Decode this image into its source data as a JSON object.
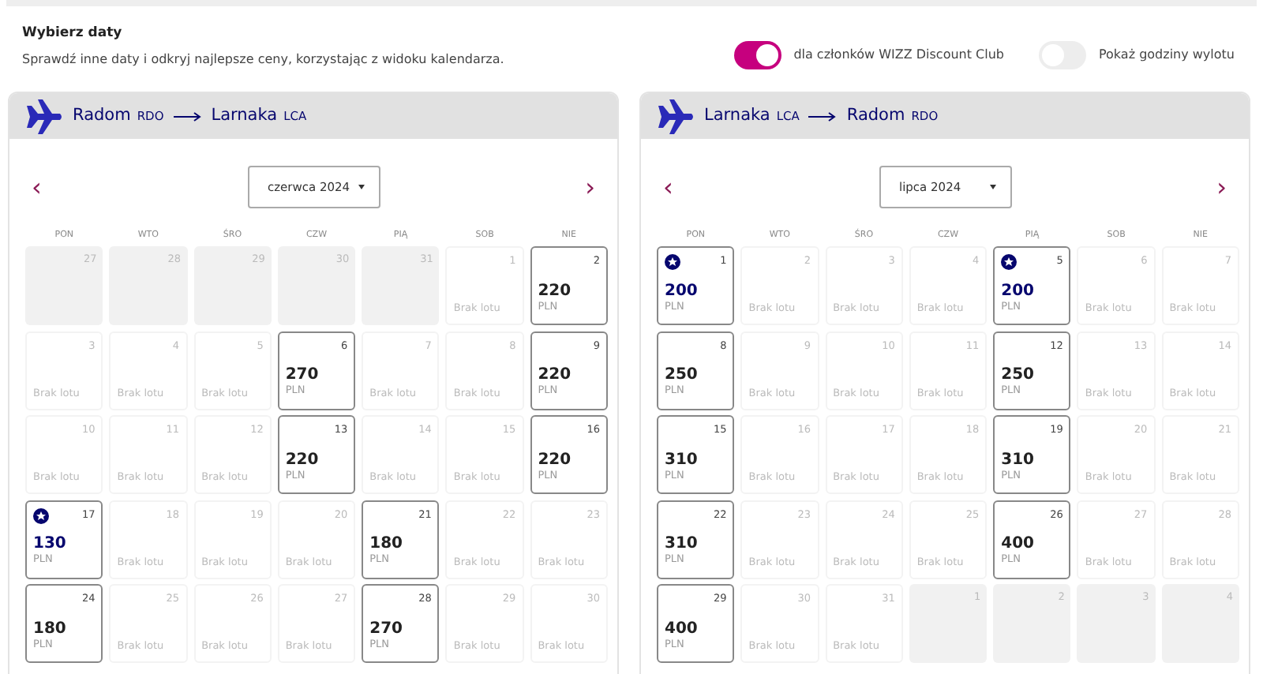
{
  "header": {
    "title": "Wybierz daty",
    "subtitle": "Sprawdź inne daty i odkryj najlepsze ceny, korzystając z widoku kalendarza."
  },
  "toggles": [
    {
      "label": "dla członków WIZZ Discount Club",
      "on": true
    },
    {
      "label": "Pokaż godziny wylotu",
      "on": false
    }
  ],
  "calendars": [
    {
      "route": {
        "from_city": "Radom",
        "from_code": "RDO",
        "to_city": "Larnaka",
        "to_code": "LCA"
      },
      "prev": "‹",
      "next": "›",
      "month": "czerwca 2024",
      "weekdays": [
        "PON",
        "WTO",
        "ŚRO",
        "CZW",
        "PIĄ",
        "SOB",
        "NIE"
      ],
      "days": [
        {
          "kind": "outside",
          "day": "27"
        },
        {
          "kind": "outside",
          "day": "28"
        },
        {
          "kind": "outside",
          "day": "29"
        },
        {
          "kind": "outside",
          "day": "30"
        },
        {
          "kind": "outside",
          "day": "31"
        },
        {
          "kind": "none",
          "day": "1",
          "note": "Brak lotu"
        },
        {
          "kind": "price",
          "day": "2",
          "price": "220",
          "currency": "PLN",
          "discount": false
        },
        {
          "kind": "none",
          "day": "3",
          "note": "Brak lotu"
        },
        {
          "kind": "none",
          "day": "4",
          "note": "Brak lotu"
        },
        {
          "kind": "none",
          "day": "5",
          "note": "Brak lotu"
        },
        {
          "kind": "price",
          "day": "6",
          "price": "270",
          "currency": "PLN",
          "discount": false
        },
        {
          "kind": "none",
          "day": "7",
          "note": "Brak lotu"
        },
        {
          "kind": "none",
          "day": "8",
          "note": "Brak lotu"
        },
        {
          "kind": "price",
          "day": "9",
          "price": "220",
          "currency": "PLN",
          "discount": false
        },
        {
          "kind": "none",
          "day": "10",
          "note": "Brak lotu"
        },
        {
          "kind": "none",
          "day": "11",
          "note": "Brak lotu"
        },
        {
          "kind": "none",
          "day": "12",
          "note": "Brak lotu"
        },
        {
          "kind": "price",
          "day": "13",
          "price": "220",
          "currency": "PLN",
          "discount": false
        },
        {
          "kind": "none",
          "day": "14",
          "note": "Brak lotu"
        },
        {
          "kind": "none",
          "day": "15",
          "note": "Brak lotu"
        },
        {
          "kind": "price",
          "day": "16",
          "price": "220",
          "currency": "PLN",
          "discount": false
        },
        {
          "kind": "price",
          "day": "17",
          "price": "130",
          "currency": "PLN",
          "discount": true
        },
        {
          "kind": "none",
          "day": "18",
          "note": "Brak lotu"
        },
        {
          "kind": "none",
          "day": "19",
          "note": "Brak lotu"
        },
        {
          "kind": "none",
          "day": "20",
          "note": "Brak lotu"
        },
        {
          "kind": "price",
          "day": "21",
          "price": "180",
          "currency": "PLN",
          "discount": false
        },
        {
          "kind": "none",
          "day": "22",
          "note": "Brak lotu"
        },
        {
          "kind": "none",
          "day": "23",
          "note": "Brak lotu"
        },
        {
          "kind": "price",
          "day": "24",
          "price": "180",
          "currency": "PLN",
          "discount": false
        },
        {
          "kind": "none",
          "day": "25",
          "note": "Brak lotu"
        },
        {
          "kind": "none",
          "day": "26",
          "note": "Brak lotu"
        },
        {
          "kind": "none",
          "day": "27",
          "note": "Brak lotu"
        },
        {
          "kind": "price",
          "day": "28",
          "price": "270",
          "currency": "PLN",
          "discount": false
        },
        {
          "kind": "none",
          "day": "29",
          "note": "Brak lotu"
        },
        {
          "kind": "none",
          "day": "30",
          "note": "Brak lotu"
        }
      ]
    },
    {
      "route": {
        "from_city": "Larnaka",
        "from_code": "LCA",
        "to_city": "Radom",
        "to_code": "RDO"
      },
      "prev": "‹",
      "next": "›",
      "month": "lipca 2024",
      "weekdays": [
        "PON",
        "WTO",
        "ŚRO",
        "CZW",
        "PIĄ",
        "SOB",
        "NIE"
      ],
      "days": [
        {
          "kind": "price",
          "day": "1",
          "price": "200",
          "currency": "PLN",
          "discount": true
        },
        {
          "kind": "none",
          "day": "2",
          "note": "Brak lotu"
        },
        {
          "kind": "none",
          "day": "3",
          "note": "Brak lotu"
        },
        {
          "kind": "none",
          "day": "4",
          "note": "Brak lotu"
        },
        {
          "kind": "price",
          "day": "5",
          "price": "200",
          "currency": "PLN",
          "discount": true
        },
        {
          "kind": "none",
          "day": "6",
          "note": "Brak lotu"
        },
        {
          "kind": "none",
          "day": "7",
          "note": "Brak lotu"
        },
        {
          "kind": "price",
          "day": "8",
          "price": "250",
          "currency": "PLN",
          "discount": false
        },
        {
          "kind": "none",
          "day": "9",
          "note": "Brak lotu"
        },
        {
          "kind": "none",
          "day": "10",
          "note": "Brak lotu"
        },
        {
          "kind": "none",
          "day": "11",
          "note": "Brak lotu"
        },
        {
          "kind": "price",
          "day": "12",
          "price": "250",
          "currency": "PLN",
          "discount": false
        },
        {
          "kind": "none",
          "day": "13",
          "note": "Brak lotu"
        },
        {
          "kind": "none",
          "day": "14",
          "note": "Brak lotu"
        },
        {
          "kind": "price",
          "day": "15",
          "price": "310",
          "currency": "PLN",
          "discount": false
        },
        {
          "kind": "none",
          "day": "16",
          "note": "Brak lotu"
        },
        {
          "kind": "none",
          "day": "17",
          "note": "Brak lotu"
        },
        {
          "kind": "none",
          "day": "18",
          "note": "Brak lotu"
        },
        {
          "kind": "price",
          "day": "19",
          "price": "310",
          "currency": "PLN",
          "discount": false
        },
        {
          "kind": "none",
          "day": "20",
          "note": "Brak lotu"
        },
        {
          "kind": "none",
          "day": "21",
          "note": "Brak lotu"
        },
        {
          "kind": "price",
          "day": "22",
          "price": "310",
          "currency": "PLN",
          "discount": false
        },
        {
          "kind": "none",
          "day": "23",
          "note": "Brak lotu"
        },
        {
          "kind": "none",
          "day": "24",
          "note": "Brak lotu"
        },
        {
          "kind": "none",
          "day": "25",
          "note": "Brak lotu"
        },
        {
          "kind": "price",
          "day": "26",
          "price": "400",
          "currency": "PLN",
          "discount": false
        },
        {
          "kind": "none",
          "day": "27",
          "note": "Brak lotu"
        },
        {
          "kind": "none",
          "day": "28",
          "note": "Brak lotu"
        },
        {
          "kind": "price",
          "day": "29",
          "price": "400",
          "currency": "PLN",
          "discount": false
        },
        {
          "kind": "none",
          "day": "30",
          "note": "Brak lotu"
        },
        {
          "kind": "none",
          "day": "31",
          "note": "Brak lotu"
        },
        {
          "kind": "outside",
          "day": "1"
        },
        {
          "kind": "outside",
          "day": "2"
        },
        {
          "kind": "outside",
          "day": "3"
        },
        {
          "kind": "outside",
          "day": "4"
        }
      ]
    }
  ]
}
